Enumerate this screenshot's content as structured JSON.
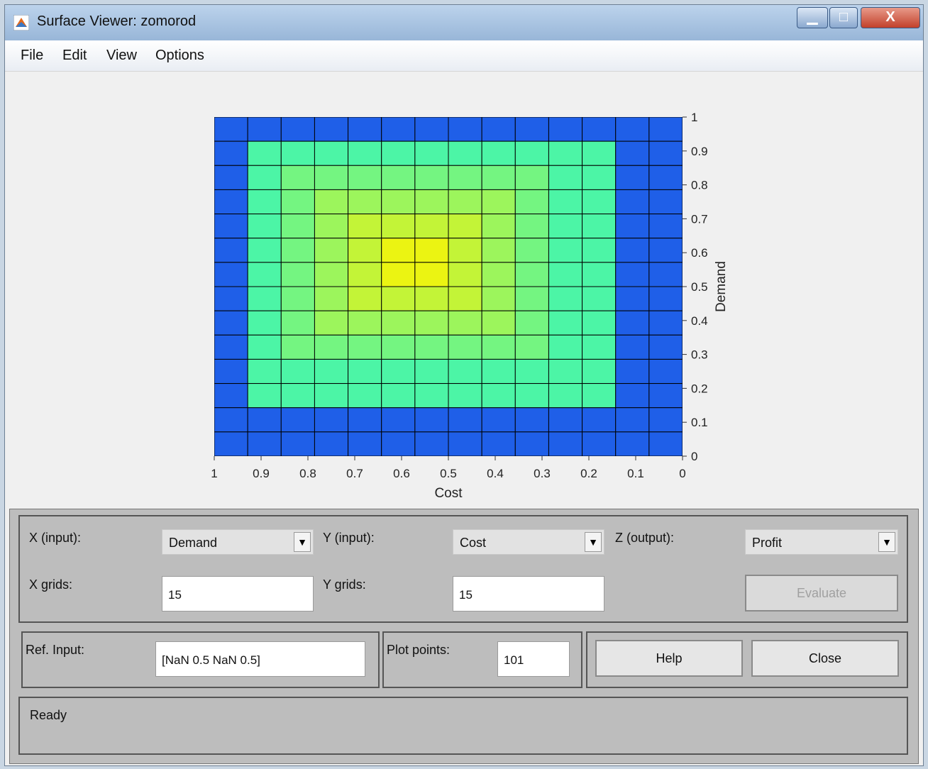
{
  "window": {
    "title": "Surface Viewer: zomorod"
  },
  "menu": {
    "items": [
      "File",
      "Edit",
      "View",
      "Options"
    ]
  },
  "chart_data": {
    "type": "heatmap",
    "xlabel": "Cost",
    "ylabel": "Demand",
    "xlim": [
      1,
      0
    ],
    "ylim": [
      0,
      1
    ],
    "x_ticks": [
      "1",
      "0.9",
      "0.8",
      "0.7",
      "0.6",
      "0.5",
      "0.4",
      "0.3",
      "0.2",
      "0.1",
      "0"
    ],
    "y_ticks": [
      "0",
      "0.1",
      "0.2",
      "0.3",
      "0.4",
      "0.5",
      "0.6",
      "0.7",
      "0.8",
      "0.9",
      "1"
    ],
    "grid_cols": 14,
    "grid_rows": 14,
    "colors": {
      "low": "#1f5fe8",
      "band": "#4cf5a6",
      "high": "#fff400"
    }
  },
  "controls": {
    "x_input_label": "X (input):",
    "x_input_value": "Demand",
    "y_input_label": "Y (input):",
    "y_input_value": "Cost",
    "z_output_label": "Z (output):",
    "z_output_value": "Profit",
    "x_grids_label": "X grids:",
    "x_grids_value": "15",
    "y_grids_label": "Y grids:",
    "y_grids_value": "15",
    "evaluate_label": "Evaluate",
    "ref_input_label": "Ref. Input:",
    "ref_input_value": "[NaN 0.5 NaN 0.5]",
    "plot_points_label": "Plot points:",
    "plot_points_value": "101",
    "help_label": "Help",
    "close_label": "Close"
  },
  "status": {
    "text": "Ready"
  }
}
